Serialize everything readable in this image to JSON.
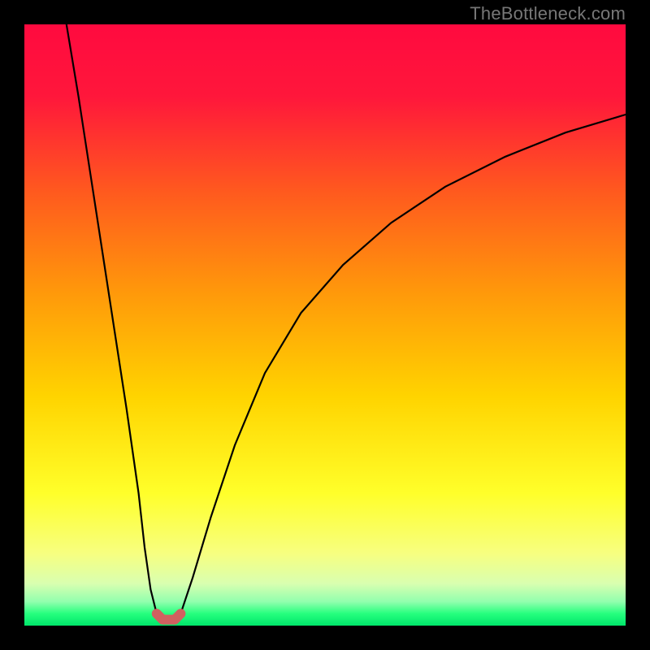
{
  "watermark": "TheBottleneck.com",
  "gradient_stops": [
    {
      "pct": 0,
      "color": "#ff0a3f"
    },
    {
      "pct": 12,
      "color": "#ff173b"
    },
    {
      "pct": 28,
      "color": "#ff5a1e"
    },
    {
      "pct": 45,
      "color": "#ff9a0a"
    },
    {
      "pct": 62,
      "color": "#ffd400"
    },
    {
      "pct": 78,
      "color": "#ffff2a"
    },
    {
      "pct": 88,
      "color": "#f7ff80"
    },
    {
      "pct": 93,
      "color": "#d9ffb0"
    },
    {
      "pct": 96,
      "color": "#92ffae"
    },
    {
      "pct": 98,
      "color": "#26ff7e"
    },
    {
      "pct": 100,
      "color": "#00e56a"
    }
  ],
  "highlight_color": "#d16060",
  "chart_data": {
    "type": "line",
    "title": "",
    "xlabel": "",
    "ylabel": "",
    "xlim": [
      0,
      100
    ],
    "ylim": [
      0,
      100
    ],
    "grid": false,
    "series": [
      {
        "name": "left-branch",
        "x": [
          7,
          9,
          11,
          13,
          15,
          17,
          19,
          20,
          21,
          22
        ],
        "y": [
          100,
          88,
          75,
          62,
          49,
          36,
          22,
          13,
          6,
          2
        ]
      },
      {
        "name": "valley",
        "x": [
          22,
          23,
          24,
          25,
          26
        ],
        "y": [
          2,
          1,
          1,
          1,
          2
        ]
      },
      {
        "name": "right-branch",
        "x": [
          26,
          28,
          31,
          35,
          40,
          46,
          53,
          61,
          70,
          80,
          90,
          100
        ],
        "y": [
          2,
          8,
          18,
          30,
          42,
          52,
          60,
          67,
          73,
          78,
          82,
          85
        ]
      }
    ],
    "annotations": []
  }
}
